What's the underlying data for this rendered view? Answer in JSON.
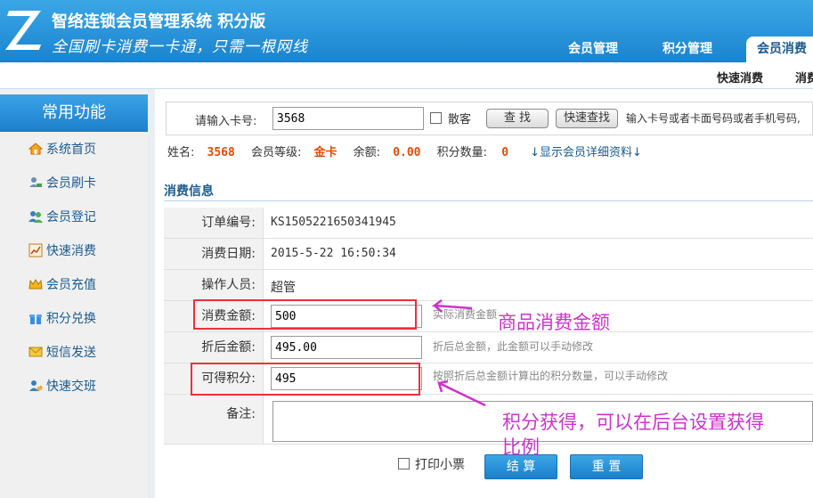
{
  "header": {
    "app_title": "智络连锁会员管理系统 积分版",
    "slogan": "全国刷卡消费一卡通，只需一根网线",
    "tabs": [
      {
        "label": "会员管理"
      },
      {
        "label": "积分管理"
      },
      {
        "label": "会员消费",
        "active": true
      }
    ]
  },
  "subbar": {
    "links": [
      "快速消费",
      "消费"
    ]
  },
  "sidebar": {
    "title": "常用功能",
    "items": [
      {
        "label": "系统首页",
        "icon": "home-icon"
      },
      {
        "label": "会员刷卡",
        "icon": "user-card-icon"
      },
      {
        "label": "会员登记",
        "icon": "user-add-icon"
      },
      {
        "label": "快速消费",
        "icon": "chart-icon"
      },
      {
        "label": "会员充值",
        "icon": "crown-icon"
      },
      {
        "label": "积分兑换",
        "icon": "gift-icon"
      },
      {
        "label": "短信发送",
        "icon": "envelope-icon"
      },
      {
        "label": "快速交班",
        "icon": "user-switch-icon"
      }
    ]
  },
  "search": {
    "card_label": "请输入卡号:",
    "card_value": "3568",
    "walkin_label": "散客",
    "find_button": "查 找",
    "quick_find_button": "快速查找",
    "hint": "输入卡号或者卡面号码或者手机号码,"
  },
  "member": {
    "name_label": "姓名:",
    "name_value": "3568",
    "level_label": "会员等级:",
    "level_value": "金卡",
    "balance_label": "余额:",
    "balance_value": "0.00",
    "points_label": "积分数量:",
    "points_value": "0",
    "detail_link": "↓显示会员详细资料↓"
  },
  "consume": {
    "section_title": "消费信息",
    "order_label": "订单编号:",
    "order_value": "KS1505221650341945",
    "date_label": "消费日期:",
    "date_value": "2015-5-22 16:50:34",
    "operator_label": "操作人员:",
    "operator_value": "超管",
    "amount_label": "消费金额:",
    "amount_value": "500",
    "amount_hint": "实际消费金额",
    "discount_label": "折后金额:",
    "discount_value": "495.00",
    "discount_hint": "折后总金额，此金额可以手动修改",
    "points_label": "可得积分:",
    "points_value": "495",
    "points_hint": "按照折后总金额计算出的积分数量，可以手动修改",
    "remark_label": "备注:",
    "print_label": "打印小票",
    "settle_button": "结 算",
    "reset_button": "重 置"
  },
  "annotations": {
    "amount_note": "商品消费金额",
    "points_note_line1": "积分获得，可以在后台设置获得",
    "points_note_line2": "比例"
  },
  "colors": {
    "brand_blue": "#1a83cf",
    "highlight_orange": "#e64a00",
    "annotation_red": "#e8323c",
    "annotation_magenta": "#cc33cc"
  }
}
